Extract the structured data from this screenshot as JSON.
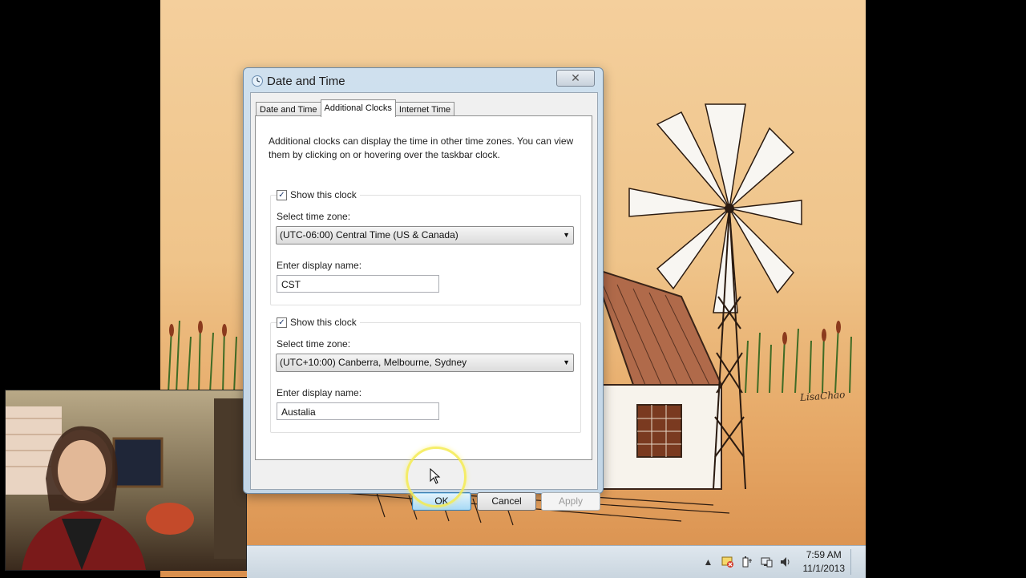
{
  "dialog": {
    "title": "Date and Time",
    "close_glyph": "✕",
    "tabs": [
      {
        "label": "Date and Time",
        "active": false
      },
      {
        "label": "Additional Clocks",
        "active": true
      },
      {
        "label": "Internet Time",
        "active": false
      }
    ],
    "description": "Additional clocks can display the time in other time zones. You can view them by clicking on or hovering over the taskbar clock.",
    "clocks": [
      {
        "show_label": "Show this clock",
        "checked": true,
        "timezone_label": "Select time zone:",
        "timezone_value": "(UTC-06:00) Central Time (US & Canada)",
        "display_name_label": "Enter display name:",
        "display_name_value": "CST"
      },
      {
        "show_label": "Show this clock",
        "checked": true,
        "timezone_label": "Select time zone:",
        "timezone_value": "(UTC+10:00) Canberra, Melbourne, Sydney",
        "display_name_label": "Enter display name:",
        "display_name_value": "Austalia"
      }
    ],
    "buttons": {
      "ok": "OK",
      "cancel": "Cancel",
      "apply": "Apply"
    },
    "check_glyph": "✓",
    "dropdown_glyph": "▼"
  },
  "taskbar": {
    "time": "7:59 AM",
    "date": "11/1/2013",
    "tray_icons": [
      "show-hidden-icons-arrow",
      "action-center-icon",
      "power-icon",
      "network-icon",
      "volume-icon"
    ],
    "tray_glyphs": {
      "arrow": "▲",
      "volume": "🔈"
    }
  },
  "wallpaper": {
    "signature": "LisaChao"
  },
  "colors": {
    "accent_ok": "#a7d9f5",
    "highlight_ring": "#f5eb50",
    "wallpaper": "#efc48a"
  }
}
